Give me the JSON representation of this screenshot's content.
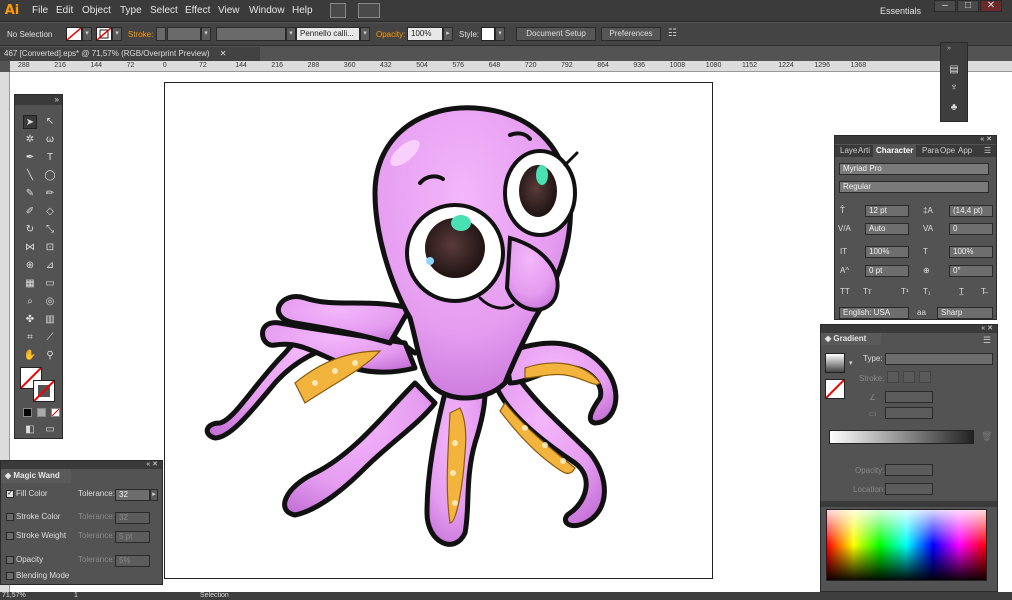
{
  "menubar": {
    "logo": "Ai",
    "items": [
      "File",
      "Edit",
      "Object",
      "Type",
      "Select",
      "Effect",
      "View",
      "Window",
      "Help"
    ],
    "workspace": "Essentials",
    "window_controls": [
      "–",
      "□",
      "✕"
    ]
  },
  "controlbar": {
    "selection": "No Selection",
    "stroke_label": "Stroke:",
    "brush": "Pennello calli...",
    "opacity_label": "Opacity:",
    "opacity_value": "100%",
    "style_label": "Style:",
    "document_setup": "Document Setup",
    "preferences": "Preferences"
  },
  "document": {
    "tab_title": "467 [Converted].eps* @ 71,57% (RGB/Overprint Preview)",
    "close": "✕",
    "ruler_labels": [
      "288",
      "216",
      "144",
      "72",
      "0",
      "72",
      "144",
      "216",
      "288",
      "360",
      "432",
      "504",
      "576",
      "648",
      "720",
      "792",
      "864",
      "936",
      "1008",
      "1080",
      "1152",
      "1224",
      "1296",
      "1368"
    ]
  },
  "status": {
    "zoom": "71,57%",
    "page": "1",
    "tool": "Selection"
  },
  "magic_wand": {
    "title": "Magic Wand",
    "rows": [
      {
        "label": "Fill Color",
        "checked": true,
        "tolerance_label": "Tolerance:",
        "value": "32",
        "enabled": true
      },
      {
        "label": "Stroke Color",
        "checked": false,
        "tolerance_label": "Tolerance:",
        "value": "32",
        "enabled": false
      },
      {
        "label": "Stroke Weight",
        "checked": false,
        "tolerance_label": "Tolerance:",
        "value": "5 pt",
        "enabled": false
      },
      {
        "label": "Opacity",
        "checked": false,
        "tolerance_label": "Tolerance:",
        "value": "5%",
        "enabled": false
      },
      {
        "label": "Blending Mode",
        "checked": false,
        "tolerance_label": "",
        "value": "",
        "enabled": false
      }
    ]
  },
  "character": {
    "tabs": [
      "Laye",
      "Arti",
      "Character",
      "Para",
      "Ope",
      "App"
    ],
    "font_family": "Myriad Pro",
    "font_style": "Regular",
    "font_size": "12 pt",
    "leading": "(14,4 pt)",
    "kerning": "Auto",
    "tracking": "0",
    "vertical_scale": "100%",
    "horizontal_scale": "100%",
    "baseline_shift": "0 pt",
    "rotation": "0°",
    "language": "English: USA",
    "antialias": "Sharp"
  },
  "gradient": {
    "title": "Gradient",
    "type_label": "Type:",
    "stroke_label": "Stroke:",
    "opacity_label": "Opacity:",
    "location_label": "Location:"
  },
  "colors": {
    "octopus_body": "#e59cf0",
    "octopus_dark": "#c36fd6",
    "suckers": "#f2b43c",
    "ai_orange": "#ff9a00"
  }
}
